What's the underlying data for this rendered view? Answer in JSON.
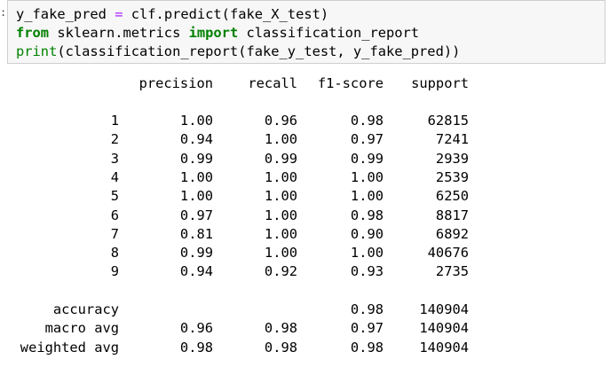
{
  "code": {
    "lines": [
      [
        {
          "t": "y_fake_pred ",
          "c": "plain"
        },
        {
          "t": "=",
          "c": "op"
        },
        {
          "t": " clf.predict(fake_X_test)",
          "c": "plain"
        }
      ],
      [
        {
          "t": "from",
          "c": "kw"
        },
        {
          "t": " sklearn.metrics ",
          "c": "plain"
        },
        {
          "t": "import",
          "c": "kw"
        },
        {
          "t": " classification_report",
          "c": "plain"
        }
      ],
      [
        {
          "t": "print",
          "c": "builtin"
        },
        {
          "t": "(classification_report(fake_y_test, y_fake_pred))",
          "c": "plain"
        }
      ]
    ]
  },
  "report": {
    "headers": [
      "precision",
      "recall",
      "f1-score",
      "support"
    ],
    "rows": [
      {
        "label": "1",
        "precision": "1.00",
        "recall": "0.96",
        "f1": "0.98",
        "support": "62815"
      },
      {
        "label": "2",
        "precision": "0.94",
        "recall": "1.00",
        "f1": "0.97",
        "support": "7241"
      },
      {
        "label": "3",
        "precision": "0.99",
        "recall": "0.99",
        "f1": "0.99",
        "support": "2939"
      },
      {
        "label": "4",
        "precision": "1.00",
        "recall": "1.00",
        "f1": "1.00",
        "support": "2539"
      },
      {
        "label": "5",
        "precision": "1.00",
        "recall": "1.00",
        "f1": "1.00",
        "support": "6250"
      },
      {
        "label": "6",
        "precision": "0.97",
        "recall": "1.00",
        "f1": "0.98",
        "support": "8817"
      },
      {
        "label": "7",
        "precision": "0.81",
        "recall": "1.00",
        "f1": "0.90",
        "support": "6892"
      },
      {
        "label": "8",
        "precision": "0.99",
        "recall": "1.00",
        "f1": "1.00",
        "support": "40676"
      },
      {
        "label": "9",
        "precision": "0.94",
        "recall": "0.92",
        "f1": "0.93",
        "support": "2735"
      }
    ],
    "summary": [
      {
        "label": "accuracy",
        "precision": "",
        "recall": "",
        "f1": "0.98",
        "support": "140904"
      },
      {
        "label": "macro avg",
        "precision": "0.96",
        "recall": "0.98",
        "f1": "0.97",
        "support": "140904"
      },
      {
        "label": "weighted avg",
        "precision": "0.98",
        "recall": "0.98",
        "f1": "0.98",
        "support": "140904"
      }
    ]
  }
}
